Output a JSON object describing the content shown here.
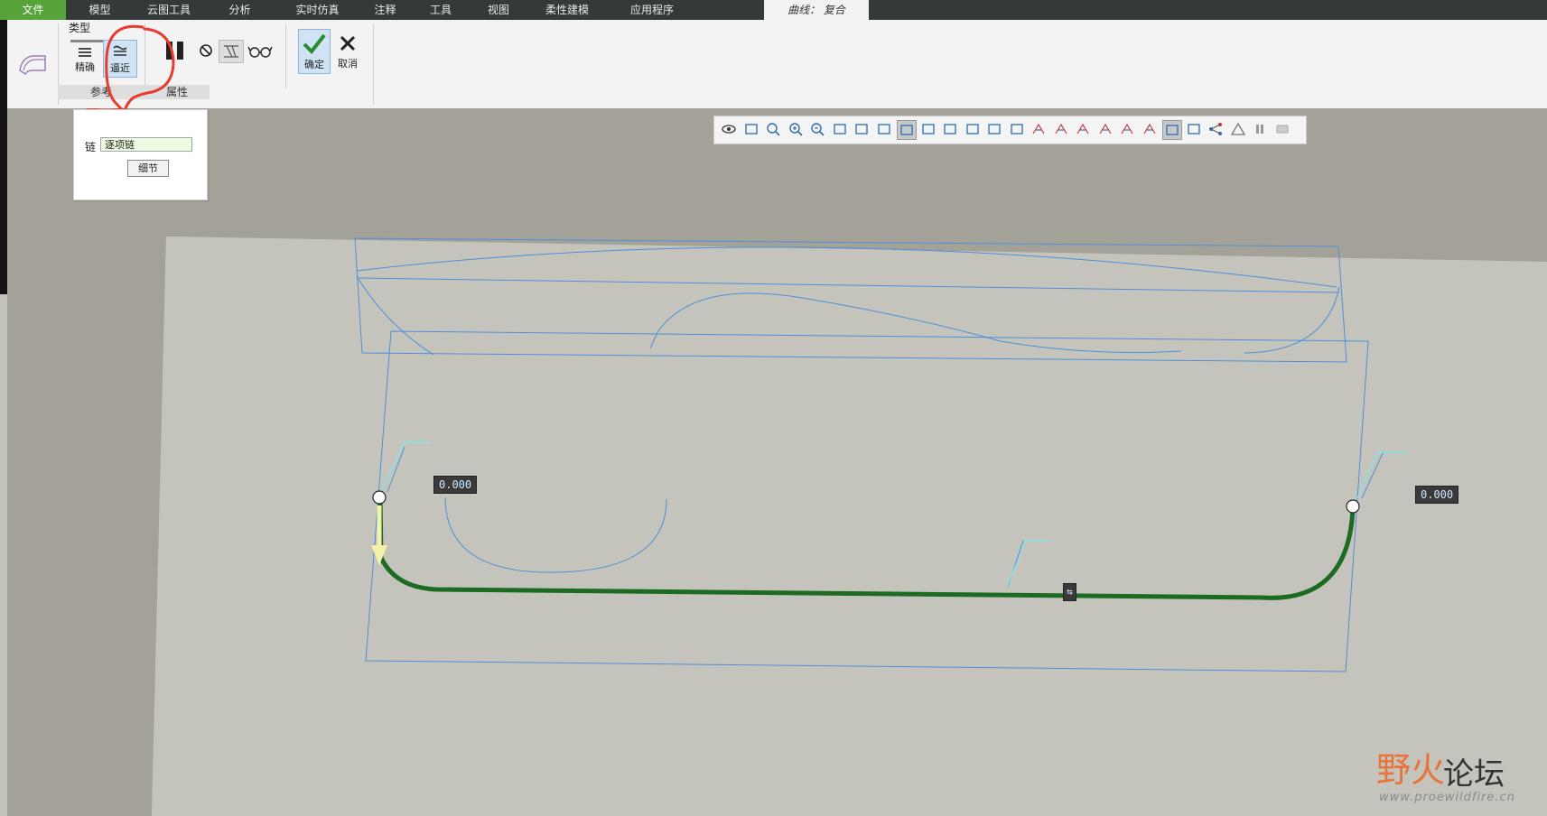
{
  "menubar": {
    "items": [
      "文件",
      "模型",
      "云图工具",
      "分析",
      "实时仿真",
      "注释",
      "工具",
      "视图",
      "柔性建模",
      "应用程序"
    ],
    "context_tab": "曲线： 复合"
  },
  "ribbon": {
    "type_group_title": "类型",
    "exact_label": "精确",
    "approx_label": "逼近",
    "ok_label": "确定",
    "cancel_label": "取消",
    "footer_tabs": [
      "参考",
      "属性"
    ]
  },
  "popup": {
    "chain_label": "链",
    "chain_value": "逐项链",
    "details_button": "细节"
  },
  "viewport": {
    "dim_left": "0.000",
    "dim_right": "0.000",
    "dim_mid_glyph": "⇆"
  },
  "watermark": {
    "brand_a": "野火",
    "brand_b": "论坛",
    "url": "www.proewildfire.cn"
  },
  "graphics_toolbar": {
    "tools": [
      "view-icon",
      "spin-center-icon",
      "zoom-box-icon",
      "zoom-in-icon",
      "zoom-out-icon",
      "refit-icon",
      "shading-icon",
      "box-icon",
      "select-icon",
      "named-views-icon",
      "saved-views-icon",
      "display-style-icon",
      "datum-plane-icon",
      "axis-icon",
      "point-icon",
      "csys-icon",
      "plane-tag-icon",
      "axis-tag-icon",
      "point-tag-icon",
      "csys-tag-icon",
      "spin-icon",
      "annotation-icon",
      "network-icon",
      "triangle-icon",
      "pause-icon",
      "disabled-icon"
    ]
  },
  "colors": {
    "menubar_bg": "#34393a",
    "file_tab": "#56a33a",
    "highlight_curve": "#1c6b22",
    "wireframe": "#4a90d9"
  }
}
